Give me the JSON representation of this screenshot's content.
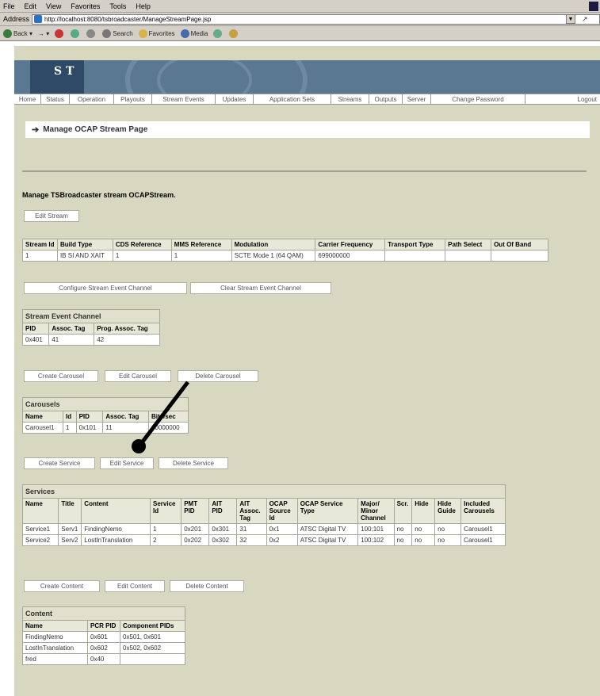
{
  "browser": {
    "menu": [
      "File",
      "Edit",
      "View",
      "Favorites",
      "Tools",
      "Help"
    ],
    "address_label": "Address",
    "url": "http://localhost:8080/tsbroadcaster/ManageStreamPage.jsp",
    "toolbar": [
      "Back",
      "Search",
      "Favorites",
      "Media"
    ]
  },
  "site": {
    "logo": "S T",
    "nav": [
      "Home",
      "Status",
      "Operation",
      "Playouts",
      "Stream Events",
      "Updates",
      "Application Sets",
      "Streams",
      "Outputs",
      "Server",
      "Change Password",
      "Logout"
    ]
  },
  "page": {
    "title": "Manage OCAP Stream Page",
    "heading": "Manage TSBroadcaster stream OCAPStream."
  },
  "buttons": {
    "edit_stream": "Edit Stream",
    "configure_sec": "Configure Stream Event Channel",
    "clear_sec": "Clear Stream Event Channel",
    "create_carousel": "Create Carousel",
    "edit_carousel": "Edit Carousel",
    "delete_carousel": "Delete Carousel",
    "create_service": "Create Service",
    "edit_service": "Edit Service",
    "delete_service": "Delete Service",
    "create_content": "Create Content",
    "edit_content": "Edit Content",
    "delete_content": "Delete Content"
  },
  "stream": {
    "headers": [
      "Stream Id",
      "Build Type",
      "CDS Reference",
      "MMS Reference",
      "Modulation",
      "Carrier Frequency",
      "Transport Type",
      "Path Select",
      "Out Of Band"
    ],
    "row": [
      "1",
      "IB SI AND XAIT",
      "1",
      "1",
      "SCTE Mode 1 (64 QAM)",
      "699000000",
      "",
      "",
      ""
    ]
  },
  "sec": {
    "caption": "Stream Event Channel",
    "headers": [
      "PID",
      "Assoc. Tag",
      "Prog. Assoc. Tag"
    ],
    "row": [
      "0x401",
      "41",
      "42"
    ]
  },
  "carousels": {
    "caption": "Carousels",
    "headers": [
      "Name",
      "Id",
      "PID",
      "Assoc. Tag",
      "Bits/sec"
    ],
    "row": [
      "Carousel1",
      "1",
      "0x101",
      "11",
      "10000000"
    ]
  },
  "services": {
    "caption": "Services",
    "headers": [
      "Name",
      "Title",
      "Content",
      "Service Id",
      "PMT PID",
      "AIT PID",
      "AIT Assoc. Tag",
      "OCAP Source Id",
      "OCAP Service Type",
      "Major/ Minor Channel",
      "Scr.",
      "Hide",
      "Hide Guide",
      "Included Carousels"
    ],
    "rows": [
      [
        "Service1",
        "Serv1",
        "FindingNemo",
        "1",
        "0x201",
        "0x301",
        "31",
        "0x1",
        "ATSC Digital TV",
        "100:101",
        "no",
        "no",
        "no",
        "Carousel1"
      ],
      [
        "Service2",
        "Serv2",
        "LostInTranslation",
        "2",
        "0x202",
        "0x302",
        "32",
        "0x2",
        "ATSC Digital TV",
        "100:102",
        "no",
        "no",
        "no",
        "Carousel1"
      ]
    ]
  },
  "content": {
    "caption": "Content",
    "headers": [
      "Name",
      "PCR PID",
      "Component PIDs"
    ],
    "rows": [
      [
        "FindingNemo",
        "0x601",
        "0x501, 0x601"
      ],
      [
        "LostInTranslation",
        "0x602",
        "0x502, 0x602"
      ],
      [
        "fred",
        "0x40",
        ""
      ]
    ]
  },
  "colors": {
    "page_bg": "#d8d8c0",
    "banner": "#5a7892",
    "annotation": "#000000"
  }
}
